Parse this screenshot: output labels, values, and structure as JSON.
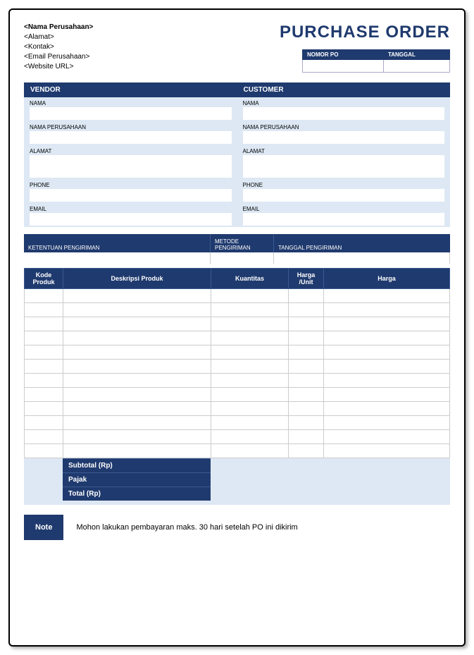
{
  "company": {
    "name": "<Nama Perusahaan>",
    "address": "<Alamat>",
    "contact": "<Kontak>",
    "email": "<Email Perusahaan>",
    "website": "<Website URL>"
  },
  "title": "PURCHASE ORDER",
  "meta": {
    "po_number_label": "NOMOR PO",
    "date_label": "TANGGAL",
    "po_number_value": "",
    "date_value": ""
  },
  "vendor": {
    "header": "VENDOR",
    "name_label": "NAMA",
    "company_label": "NAMA PERUSAHAAN",
    "address_label": "ALAMAT",
    "phone_label": "PHONE",
    "email_label": "EMAIL",
    "name_value": "",
    "company_value": "",
    "address_value": "",
    "phone_value": "",
    "email_value": ""
  },
  "customer": {
    "header": "CUSTOMER",
    "name_label": "NAMA",
    "company_label": "NAMA PERUSAHAAN",
    "address_label": "ALAMAT",
    "phone_label": "PHONE",
    "email_label": "EMAIL",
    "name_value": "",
    "company_value": "",
    "address_value": "",
    "phone_value": "",
    "email_value": ""
  },
  "shipping": {
    "terms_label": "KETENTUAN PENGIRIMAN",
    "method_label": "METODE PENGIRIMAN",
    "date_label": "TANGGAL PENGIRIMAN",
    "terms_value": "",
    "method_value": "",
    "date_value": ""
  },
  "items_header": {
    "code": "Kode Produk",
    "desc": "Deskripsi Produk",
    "qty": "Kuantitas",
    "unit": "Harga /Unit",
    "price": "Harga"
  },
  "items_row_count": 12,
  "totals": {
    "subtotal_label": "Subtotal (Rp)",
    "tax_label": "Pajak",
    "total_label": "Total (Rp)"
  },
  "note": {
    "label": "Note",
    "text": "Mohon lakukan pembayaran maks. 30 hari setelah PO ini dikirim"
  }
}
